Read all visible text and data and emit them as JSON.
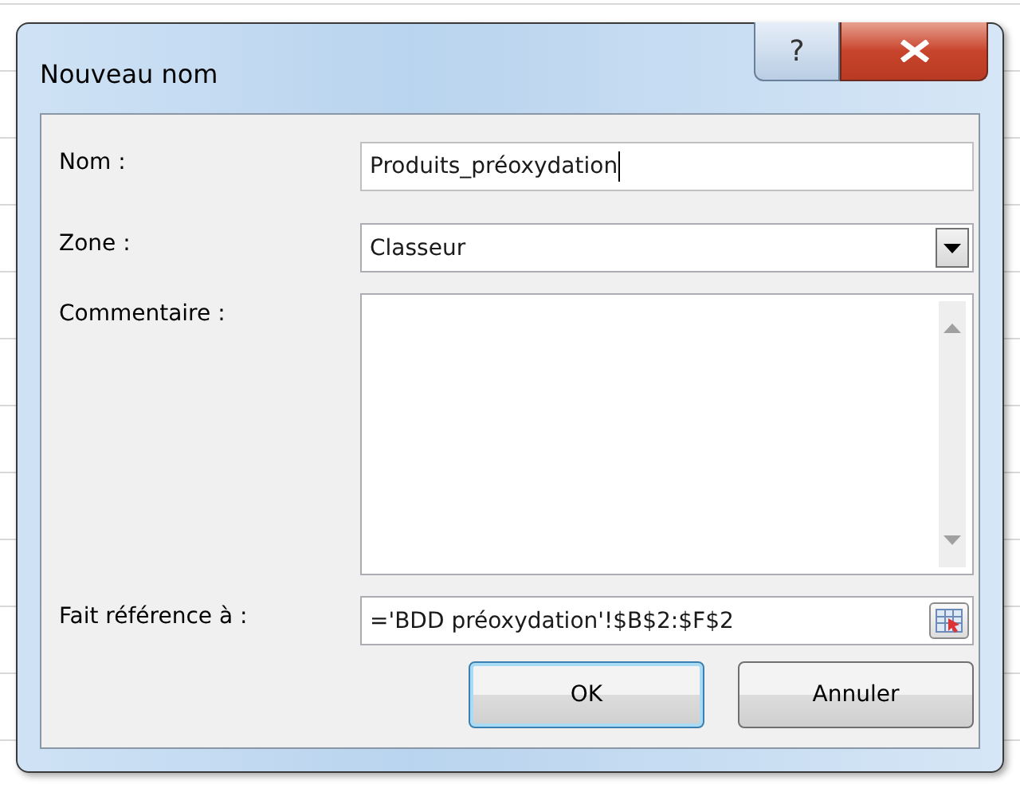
{
  "window": {
    "title": "Nouveau nom",
    "help_button": "?"
  },
  "fields": [
    {
      "kind": "text",
      "label": "Nom :",
      "value": "Produits_préoxydation",
      "focused": true
    },
    {
      "kind": "combo",
      "label": "Zone :",
      "value": "Classeur"
    },
    {
      "kind": "textarea",
      "label": "Commentaire :"
    },
    {
      "kind": "reference",
      "label": "Fait référence à :",
      "value": "='BDD préoxydation'!$B$2:$F$2"
    }
  ],
  "buttons": [
    {
      "label": "OK",
      "default": true
    },
    {
      "label": "Annuler",
      "default": false
    }
  ]
}
